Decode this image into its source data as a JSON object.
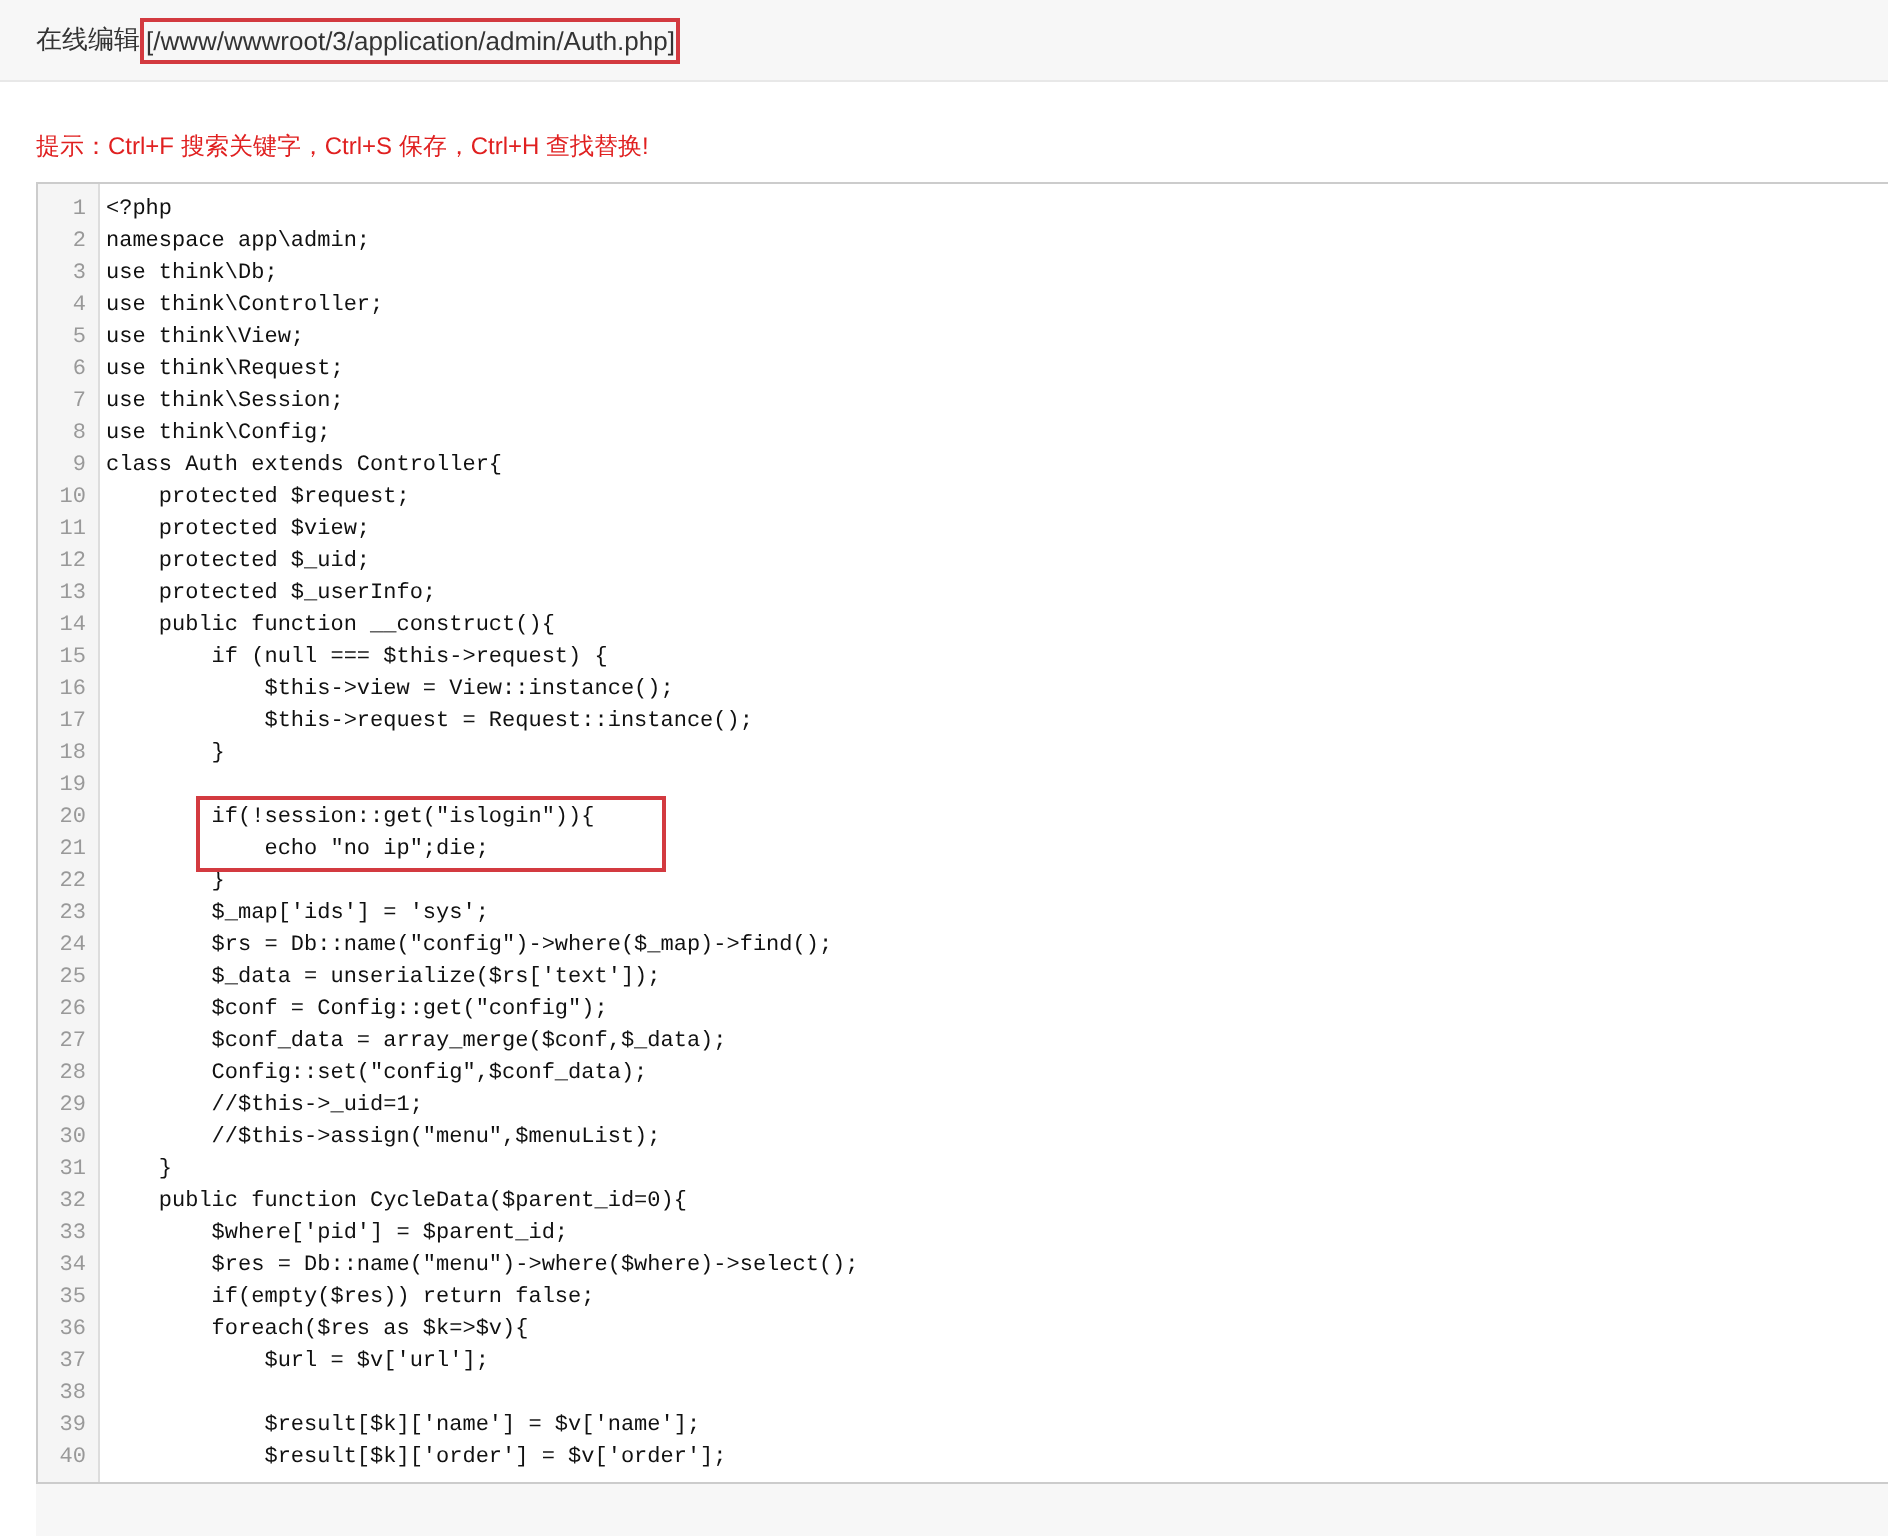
{
  "header": {
    "title": "在线编辑",
    "path": {
      "text": "[/www/wwwroot/3/application/admin/Auth.php]",
      "highlighted": true
    }
  },
  "hint": "提示：Ctrl+F 搜索关键字，Ctrl+S 保存，Ctrl+H 查找替换!",
  "editor": {
    "lines": [
      {
        "number": "1",
        "text": "<?php",
        "highlighted": false
      },
      {
        "number": "2",
        "text": "namespace app\\admin;",
        "highlighted": false
      },
      {
        "number": "3",
        "text": "use think\\Db;",
        "highlighted": false
      },
      {
        "number": "4",
        "text": "use think\\Controller;",
        "highlighted": false
      },
      {
        "number": "5",
        "text": "use think\\View;",
        "highlighted": false
      },
      {
        "number": "6",
        "text": "use think\\Request;",
        "highlighted": false
      },
      {
        "number": "7",
        "text": "use think\\Session;",
        "highlighted": false
      },
      {
        "number": "8",
        "text": "use think\\Config;",
        "highlighted": false
      },
      {
        "number": "9",
        "text": "class Auth extends Controller{",
        "highlighted": false
      },
      {
        "number": "10",
        "text": "    protected $request;",
        "highlighted": false
      },
      {
        "number": "11",
        "text": "    protected $view;",
        "highlighted": false
      },
      {
        "number": "12",
        "text": "    protected $_uid;",
        "highlighted": false
      },
      {
        "number": "13",
        "text": "    protected $_userInfo;",
        "highlighted": false
      },
      {
        "number": "14",
        "text": "    public function __construct(){",
        "highlighted": false
      },
      {
        "number": "15",
        "text": "        if (null === $this->request) {",
        "highlighted": false
      },
      {
        "number": "16",
        "text": "            $this->view = View::instance();",
        "highlighted": false
      },
      {
        "number": "17",
        "text": "            $this->request = Request::instance();",
        "highlighted": false
      },
      {
        "number": "18",
        "text": "        }",
        "highlighted": false
      },
      {
        "number": "19",
        "highlighted": false
      },
      {
        "number": "20",
        "text": "        if(!session::get(\"islogin\")){",
        "highlighted": true
      },
      {
        "number": "21",
        "text": "            echo \"no ip\";die;",
        "highlighted": true
      },
      {
        "number": "22",
        "text": "        }",
        "highlighted": false
      },
      {
        "number": "23",
        "text": "        $_map['ids'] = 'sys';",
        "highlighted": false
      },
      {
        "number": "24",
        "text": "        $rs = Db::name(\"config\")->where($_map)->find();",
        "highlighted": false
      },
      {
        "number": "25",
        "text": "        $_data = unserialize($rs['text']);",
        "highlighted": false
      },
      {
        "number": "26",
        "text": "        $conf = Config::get(\"config\");",
        "highlighted": false
      },
      {
        "number": "27",
        "text": "        $conf_data = array_merge($conf,$_data);",
        "highlighted": false
      },
      {
        "number": "28",
        "text": "        Config::set(\"config\",$conf_data);",
        "highlighted": false
      },
      {
        "number": "29",
        "text": "        //$this->_uid=1;",
        "highlighted": false
      },
      {
        "number": "30",
        "text": "        //$this->assign(\"menu\",$menuList);",
        "highlighted": false
      },
      {
        "number": "31",
        "text": "    }",
        "highlighted": false
      },
      {
        "number": "32",
        "text": "    public function CycleData($parent_id=0){",
        "highlighted": false
      },
      {
        "number": "33",
        "text": "        $where['pid'] = $parent_id;",
        "highlighted": false
      },
      {
        "number": "34",
        "text": "        $res = Db::name(\"menu\")->where($where)->select();",
        "highlighted": false
      },
      {
        "number": "35",
        "text": "        if(empty($res)) return false;",
        "highlighted": false
      },
      {
        "number": "36",
        "text": "        foreach($res as $k=>$v){",
        "highlighted": false
      },
      {
        "number": "37",
        "text": "            $url = $v['url'];",
        "highlighted": false
      },
      {
        "number": "38",
        "highlighted": false
      },
      {
        "number": "39",
        "text": "            $result[$k]['name'] = $v['name'];",
        "highlighted": false
      },
      {
        "number": "40",
        "text": "            $result[$k]['order'] = $v['order'];",
        "highlighted": false
      }
    ]
  }
}
